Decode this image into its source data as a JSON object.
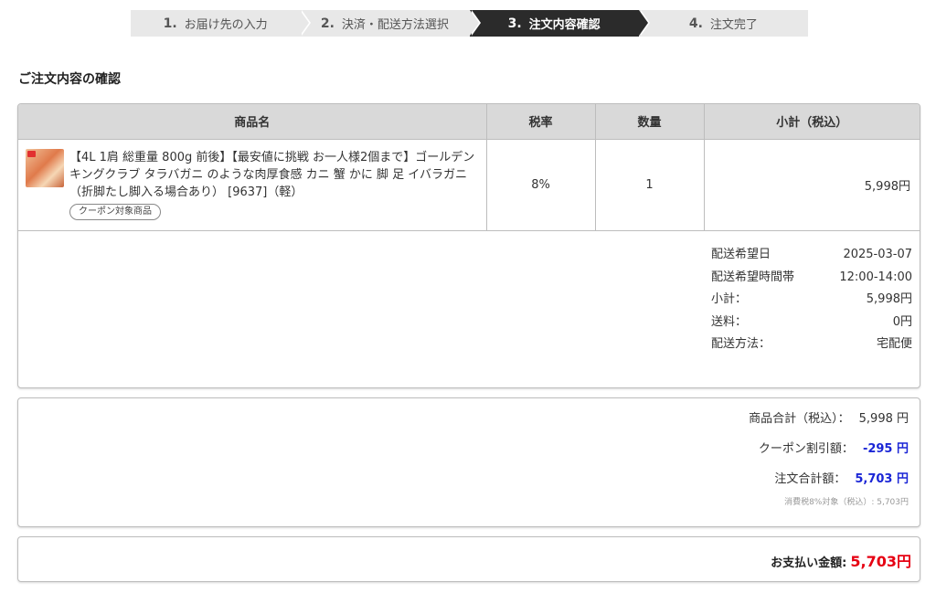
{
  "steps": [
    {
      "num": "1.",
      "label": "お届け先の入力"
    },
    {
      "num": "2.",
      "label": "決済・配送方法選択"
    },
    {
      "num": "3.",
      "label": "注文内容確認"
    },
    {
      "num": "4.",
      "label": "注文完了"
    }
  ],
  "active_step": 3,
  "section_title": "ご注文内容の確認",
  "table": {
    "headers": [
      "商品名",
      "税率",
      "数量",
      "小計（税込）"
    ],
    "rows": [
      {
        "name": "【4L 1肩 総重量 800g 前後】【最安値に挑戦 お一人様2個まで】ゴールデンキングクラブ タラバガニ のような肉厚食感 カニ 蟹 かに 脚 足 イバラガニ （折脚たし脚入る場合あり） [9637]（軽）",
        "tag": "クーポン対象商品",
        "tax": "8%",
        "qty": "1",
        "subtotal": "5,998円"
      }
    ]
  },
  "shipping": [
    {
      "label": "配送希望日",
      "value": "2025-03-07"
    },
    {
      "label": "配送希望時間帯",
      "value": "12:00-14:00"
    },
    {
      "label": "小計：",
      "value": "5,998円"
    },
    {
      "label": "送料：",
      "value": "0円"
    },
    {
      "label": "配送方法：",
      "value": "宅配便"
    }
  ],
  "totals": {
    "goods_label": "商品合計（税込）：",
    "goods_value": "5,998 円",
    "coupon_label": "クーポン割引額：",
    "coupon_value": "-295 円",
    "order_label": "注文合計額：",
    "order_value": "5,703 円",
    "tax_note": "消費税8%対象（税込）: 5,703円"
  },
  "payment": {
    "label": "お支払い金額:",
    "value": "5,703円"
  },
  "colors": {
    "accent_blue": "#1a25d6",
    "accent_red": "#e60012",
    "active_step_bg": "#2b2b2b"
  }
}
